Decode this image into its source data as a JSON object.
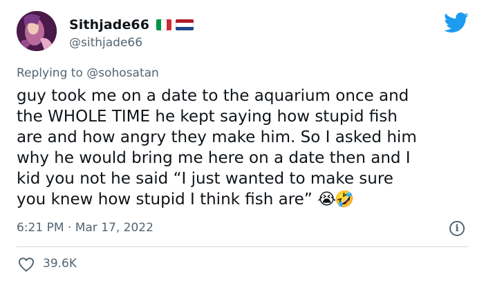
{
  "author": {
    "display_name": "Sithjade66",
    "handle": "@sithjade66",
    "flags": [
      "italy-flag",
      "netherlands-flag"
    ]
  },
  "reply_context": {
    "prefix": "Replying to ",
    "mention": "@sohosatan"
  },
  "tweet": {
    "text": "guy took me on a date to the aquarium once and\nthe WHOLE TIME he kept saying how stupid fish\nare and how angry they make him. So I asked him\nwhy he would bring me here on a date then and I\nkid you not he said “I just wanted to make sure\nyou knew how stupid I think fish are” ",
    "emojis": "😭🤣",
    "timestamp": "6:21 PM · Mar 17, 2022",
    "like_count": "39.6K"
  },
  "colors": {
    "text": "#0f1419",
    "secondary": "#536471",
    "twitter_blue": "#1d9bf0",
    "divider": "#cfd9de"
  },
  "icons": {
    "brand": "twitter-bird-icon",
    "info": "info-icon",
    "like": "heart-icon"
  }
}
